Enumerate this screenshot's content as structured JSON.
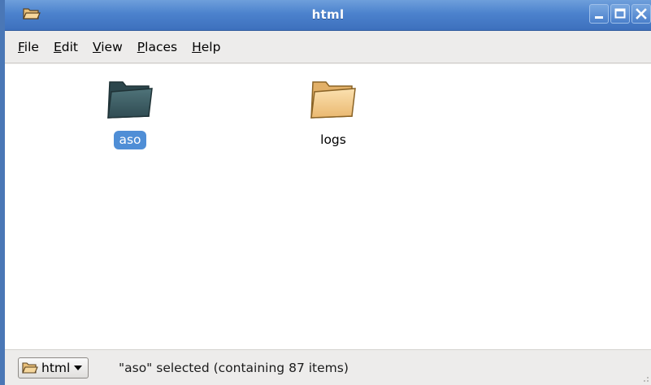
{
  "window": {
    "title": "html"
  },
  "menubar": {
    "items": [
      {
        "mnemonic": "F",
        "rest": "ile"
      },
      {
        "mnemonic": "E",
        "rest": "dit"
      },
      {
        "mnemonic": "V",
        "rest": "iew"
      },
      {
        "mnemonic": "P",
        "rest": "laces"
      },
      {
        "mnemonic": "H",
        "rest": "elp"
      }
    ]
  },
  "files": [
    {
      "name": "aso",
      "icon": "folder-dark-icon",
      "selected": true
    },
    {
      "name": "logs",
      "icon": "folder-icon",
      "selected": false
    }
  ],
  "statusbar": {
    "path_label": "html",
    "status": "\"aso\" selected (containing 87 items)"
  },
  "colors": {
    "titlebar": "#4c82cd",
    "selection": "#4f8ed6",
    "folder_tan": "#f0c888",
    "folder_dark": "#3d5f66"
  }
}
